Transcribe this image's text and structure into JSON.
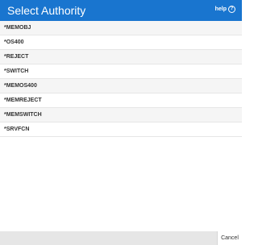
{
  "header": {
    "title": "Select Authority",
    "help_label": "help",
    "help_icon": "?"
  },
  "authorities": [
    "*MEMOBJ",
    "*OS400",
    "*REJECT",
    "*SWITCH",
    "*MEMOS400",
    "*MEMREJECT",
    "*MEMSWITCH",
    "*SRVFCN"
  ],
  "footer": {
    "cancel_label": "Cancel"
  },
  "colors": {
    "header_bg": "#1975cf",
    "row_alt_bg": "#f5f5f5",
    "footer_bg": "#e6e6e6"
  }
}
